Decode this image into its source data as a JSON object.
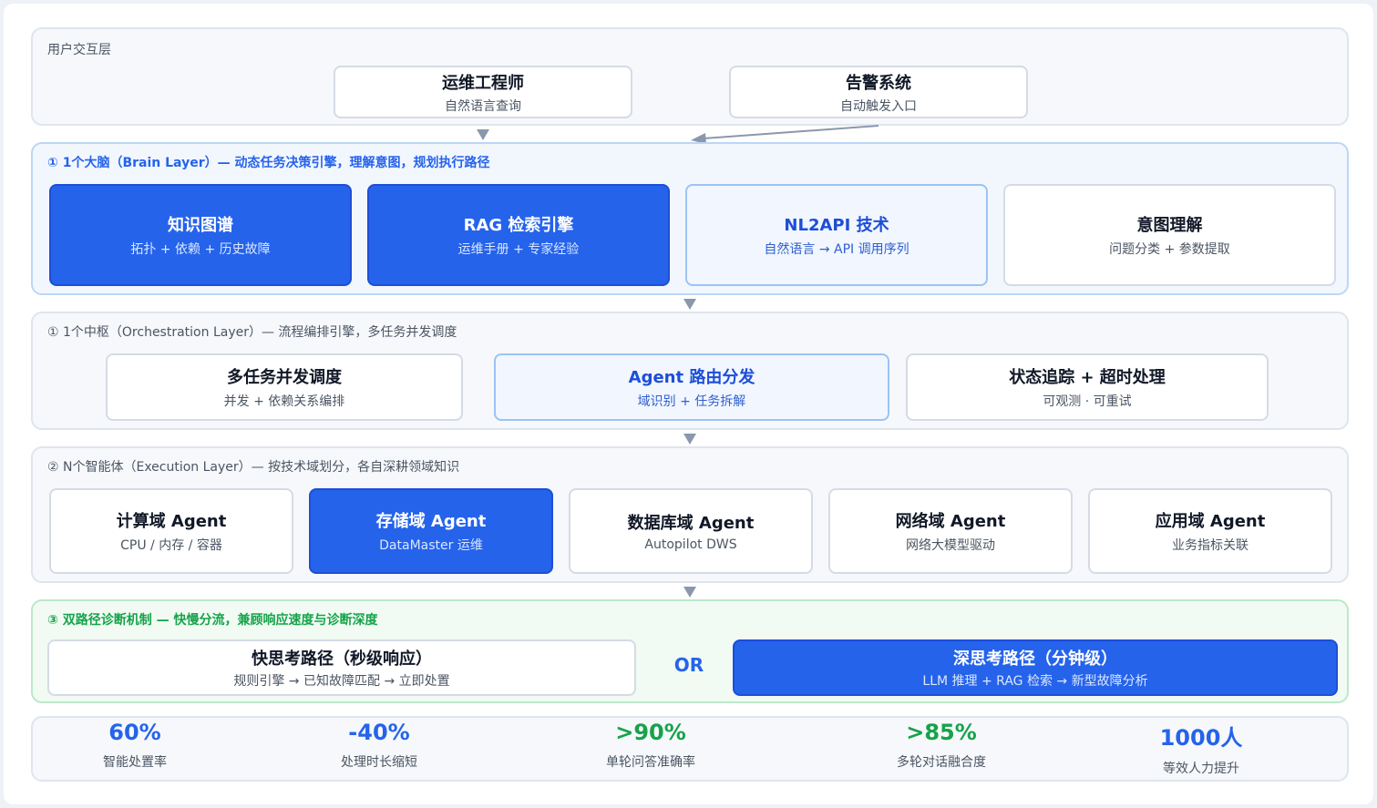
{
  "user_layer": {
    "title": "用户交互层",
    "nodes": [
      {
        "title": "运维工程师",
        "subtitle": "自然语言查询"
      },
      {
        "title": "告警系统",
        "subtitle": "自动触发入口"
      }
    ]
  },
  "brain_layer": {
    "title": "① 1个大脑（Brain Layer）— 动态任务决策引擎，理解意图，规划执行路径",
    "nodes": [
      {
        "title": "知识图谱",
        "subtitle": "拓扑 + 依赖 + 历史故障"
      },
      {
        "title": "RAG 检索引擎",
        "subtitle": "运维手册 + 专家经验"
      },
      {
        "title": "NL2API 技术",
        "subtitle": "自然语言 → API 调用序列"
      },
      {
        "title": "意图理解",
        "subtitle": "问题分类 + 参数提取"
      }
    ]
  },
  "orchestration_layer": {
    "title": "① 1个中枢（Orchestration Layer）— 流程编排引擎，多任务并发调度",
    "nodes": [
      {
        "title": "多任务并发调度",
        "subtitle": "并发 + 依赖关系编排"
      },
      {
        "title": "Agent 路由分发",
        "subtitle": "域识别 + 任务拆解"
      },
      {
        "title": "状态追踪 + 超时处理",
        "subtitle": "可观测 · 可重试"
      }
    ]
  },
  "execution_layer": {
    "title": "② N个智能体（Execution Layer）— 按技术域划分，各自深耕领域知识",
    "nodes": [
      {
        "title": "计算域 Agent",
        "subtitle": "CPU / 内存 / 容器"
      },
      {
        "title": "存储域 Agent",
        "subtitle": "DataMaster 运维"
      },
      {
        "title": "数据库域 Agent",
        "subtitle": "Autopilot DWS"
      },
      {
        "title": "网络域 Agent",
        "subtitle": "网络大模型驱动"
      },
      {
        "title": "应用域 Agent",
        "subtitle": "业务指标关联"
      }
    ]
  },
  "diagnosis_layer": {
    "title": "③ 双路径诊断机制 — 快慢分流，兼顾响应速度与诊断深度",
    "fast": {
      "title": "快思考路径（秒级响应）",
      "subtitle": "规则引擎 → 已知故障匹配 → 立即处置"
    },
    "or_label": "OR",
    "slow": {
      "title": "深思考路径（分钟级）",
      "subtitle": "LLM 推理 + RAG 检索 → 新型故障分析"
    }
  },
  "stats": [
    {
      "value": "60%",
      "label": "智能处置率",
      "color": "#2563eb"
    },
    {
      "value": "-40%",
      "label": "处理时长缩短",
      "color": "#2563eb"
    },
    {
      "value": ">90%",
      "label": "单轮问答准确率",
      "color": "#16a34a"
    },
    {
      "value": ">85%",
      "label": "多轮对话融合度",
      "color": "#16a34a"
    },
    {
      "value": "1000人",
      "label": "等效人力提升",
      "color": "#2563eb"
    }
  ],
  "colors": {
    "primary": "#2563eb",
    "green": "#16a34a",
    "brain_border": "#bcd6f7",
    "diagnosis_border": "#bde8c9"
  }
}
